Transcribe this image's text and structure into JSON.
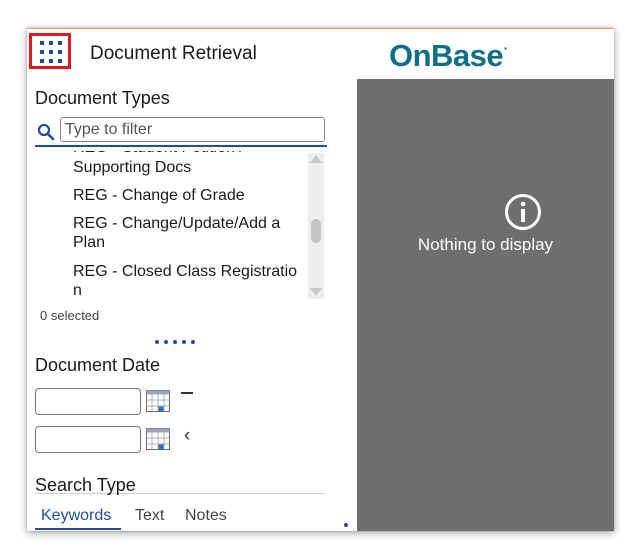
{
  "colors": {
    "accent": "#1f4f9c",
    "brand": "#0e6f86",
    "highlight": "#e0191f",
    "viewer_bg": "#6e6e6e"
  },
  "header": {
    "menu_icon": "app-grid-icon",
    "title": "Document Retrieval",
    "logo_text": "OnBase",
    "logo_mark": "•"
  },
  "document_types": {
    "heading": "Document Types",
    "filter": {
      "placeholder": "Type to filter",
      "value": "",
      "icon": "search-icon"
    },
    "items": [
      "Supporting Docs",
      "REG - Change of Grade",
      "REG - Change/Update/Add a Plan",
      "REG - Closed Class Registration"
    ],
    "selected_count": "0 selected"
  },
  "document_date": {
    "heading": "Document Date",
    "from": "",
    "to": "",
    "calendar_icon": "calendar-icon",
    "range_dash_icon": "range-dash-icon",
    "collapse_icon": "chevron-left-icon"
  },
  "search_type": {
    "heading": "Search Type",
    "tabs": [
      {
        "label": "Keywords",
        "active": true
      },
      {
        "label": "Text",
        "active": false
      },
      {
        "label": "Notes",
        "active": false
      }
    ]
  },
  "viewer": {
    "icon": "info-icon",
    "message": "Nothing to display"
  }
}
